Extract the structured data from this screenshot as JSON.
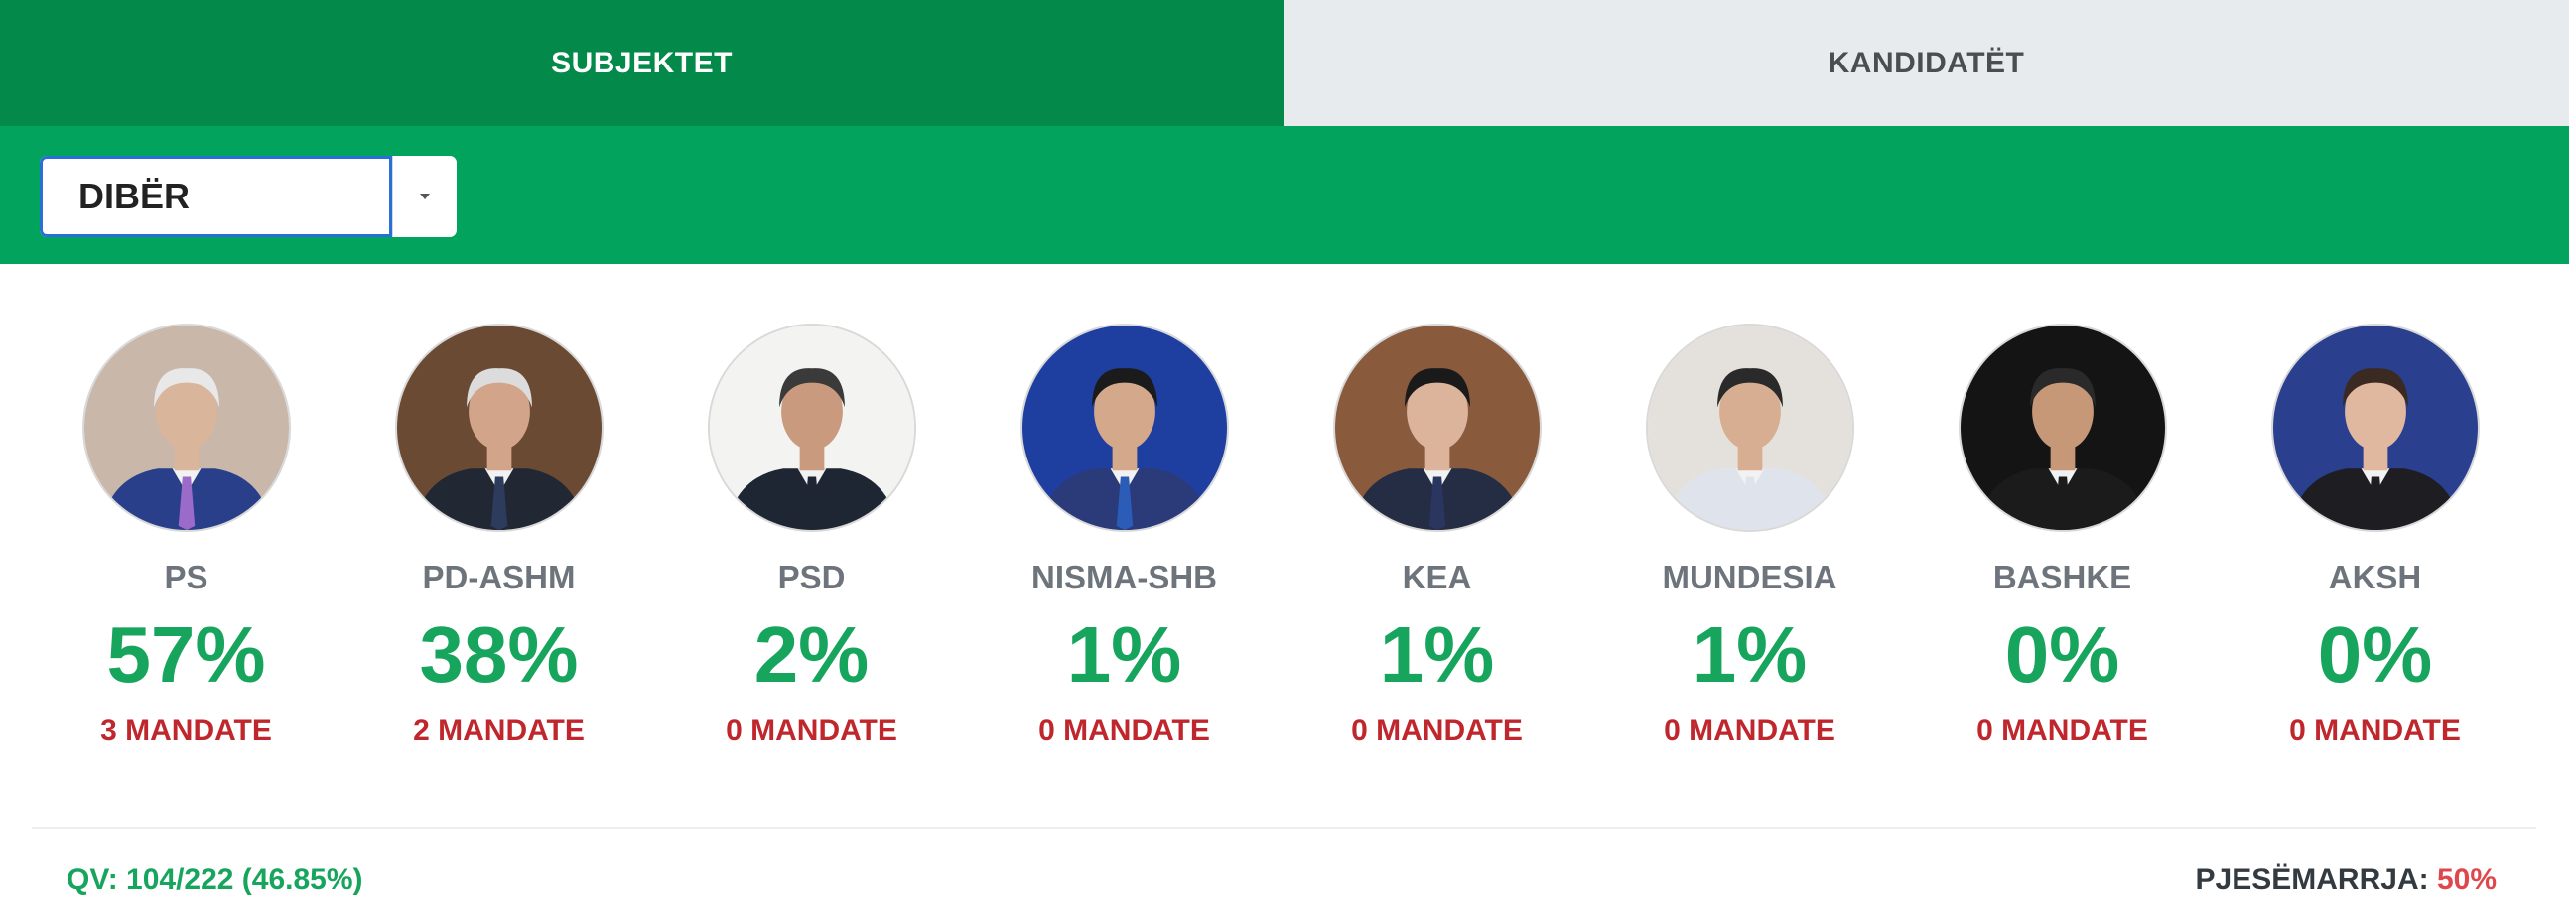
{
  "tabs": {
    "subjects": "SUBJEKTET",
    "candidates": "KANDIDATËT"
  },
  "filter": {
    "selected": "DIBËR"
  },
  "parties": [
    {
      "name": "PS",
      "percent": "57%",
      "mandates": "3 MANDATE",
      "portrait_bg": "#c9b7aa",
      "suit": "#2a3f8a",
      "tie": "#9a6bc9",
      "skin": "#d9b59c",
      "hair": "#e8e8e8"
    },
    {
      "name": "PD-ASHM",
      "percent": "38%",
      "mandates": "2 MANDATE",
      "portrait_bg": "#6b4a34",
      "suit": "#222833",
      "tie": "#2d3b5c",
      "skin": "#d2a48a",
      "hair": "#dcdcdc"
    },
    {
      "name": "PSD",
      "percent": "2%",
      "mandates": "0 MANDATE",
      "portrait_bg": "#f3f4f2",
      "suit": "#1e2533",
      "tie": "#1e2533",
      "skin": "#c99a7d",
      "hair": "#3a3a3a"
    },
    {
      "name": "NISMA-SHB",
      "percent": "1%",
      "mandates": "0 MANDATE",
      "portrait_bg": "#1f3fa0",
      "suit": "#2b3a78",
      "tie": "#2b5cb8",
      "skin": "#d4a88a",
      "hair": "#1b1b1b"
    },
    {
      "name": "KEA",
      "percent": "1%",
      "mandates": "0 MANDATE",
      "portrait_bg": "#8a5a3c",
      "suit": "#252d45",
      "tie": "#2a3560",
      "skin": "#dcb39b",
      "hair": "#1a1a1a"
    },
    {
      "name": "MUNDESIA",
      "percent": "1%",
      "mandates": "0 MANDATE",
      "portrait_bg": "#e4e1dc",
      "suit": "#dfe4ec",
      "tie": "#dfe4ec",
      "skin": "#d8ae93",
      "hair": "#2a2a2a"
    },
    {
      "name": "BASHKE",
      "percent": "0%",
      "mandates": "0 MANDATE",
      "portrait_bg": "#141414",
      "suit": "#1b1b1b",
      "tie": "#1b1b1b",
      "skin": "#c79878",
      "hair": "#2a2a2a"
    },
    {
      "name": "AKSH",
      "percent": "0%",
      "mandates": "0 MANDATE",
      "portrait_bg": "#2b3f8f",
      "suit": "#1e1e22",
      "tie": "#1e1e22",
      "skin": "#e0b8a0",
      "hair": "#3a2a22"
    }
  ],
  "footer": {
    "qv": "QV: 104/222 (46.85%)",
    "turnout_label": "PJESËMARRJA:",
    "turnout_value": "50%"
  }
}
